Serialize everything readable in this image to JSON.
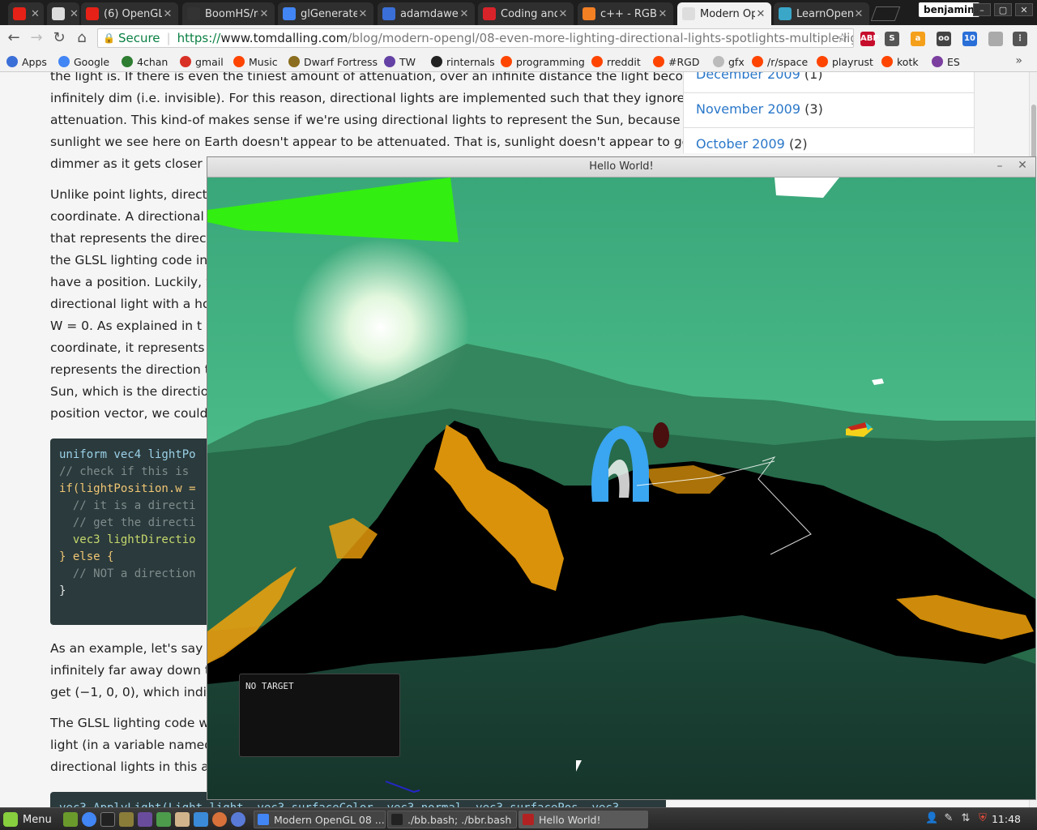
{
  "browser": {
    "tabs": [
      {
        "title": "",
        "favicon": "youtube-icon",
        "color": "#e62117"
      },
      {
        "title": "",
        "favicon": "page-icon",
        "color": "#dddddd"
      },
      {
        "title": "(6) OpenGL",
        "favicon": "youtube-icon",
        "color": "#e62117"
      },
      {
        "title": "BoomHS/re",
        "favicon": "github-icon",
        "color": "#333333"
      },
      {
        "title": "glGenerate",
        "favicon": "google-icon",
        "color": "#4285f4"
      },
      {
        "title": "adamdawe",
        "favicon": "docs-icon",
        "color": "#3b6fd8"
      },
      {
        "title": "Coding and",
        "favicon": "pen-icon",
        "color": "#d9232a"
      },
      {
        "title": "c++ - RGB",
        "favicon": "stackoverflow-icon",
        "color": "#f48024"
      },
      {
        "title": "Modern Op",
        "favicon": "page-icon",
        "color": "#dddddd"
      },
      {
        "title": "LearnOpen",
        "favicon": "learnopengl-icon",
        "color": "#3aa6c8"
      }
    ],
    "user_name": "benjamin",
    "window_controls": [
      "–",
      "▢",
      "✕"
    ],
    "url": {
      "secure_label": "Secure",
      "scheme": "https://",
      "host": "www.tomdalling.com",
      "path": "/blog/modern-opengl/08-even-more-lighting-directional-lights-spotlights-multiple-lights/"
    },
    "extensions": [
      {
        "name": "adblock-icon",
        "label": "ABP",
        "color": "#c70d2c"
      },
      {
        "name": "s-extension-icon",
        "label": "S",
        "color": "#555555"
      },
      {
        "name": "amazon-icon",
        "label": "a",
        "color": "#f5a01a"
      },
      {
        "name": "eyes-extension-icon",
        "label": "oo",
        "color": "#444444"
      },
      {
        "name": "network-extension-icon",
        "label": "10",
        "color": "#2a6fd8"
      },
      {
        "name": "blank-extension-icon",
        "label": "",
        "color": "#aaaaaa"
      },
      {
        "name": "menu-icon",
        "label": "⋮",
        "color": "#555555"
      }
    ],
    "bookmarks": [
      {
        "label": "Apps",
        "icon": "apps-grid-icon",
        "color": "#3b6fd8"
      },
      {
        "label": "Google",
        "icon": "google-icon",
        "color": "#4285f4"
      },
      {
        "label": "4chan",
        "icon": "clover-icon",
        "color": "#2e7d32"
      },
      {
        "label": "gmail",
        "icon": "gmail-icon",
        "color": "#d93025"
      },
      {
        "label": "Music",
        "icon": "reddit-icon",
        "color": "#ff4500"
      },
      {
        "label": "Dwarf Fortress",
        "icon": "df-icon",
        "color": "#8a6d1e"
      },
      {
        "label": "TW",
        "icon": "twitch-icon",
        "color": "#6441a4"
      },
      {
        "label": "rinternals",
        "icon": "github-icon",
        "color": "#222222"
      },
      {
        "label": "programming",
        "icon": "reddit-icon",
        "color": "#ff4500"
      },
      {
        "label": "rreddit",
        "icon": "reddit-icon",
        "color": "#ff4500"
      },
      {
        "label": "#RGD",
        "icon": "reddit-icon",
        "color": "#ff4500"
      },
      {
        "label": "gfx",
        "icon": "page-icon",
        "color": "#bbbbbb"
      },
      {
        "label": "/r/space",
        "icon": "reddit-icon",
        "color": "#ff4500"
      },
      {
        "label": "playrust",
        "icon": "reddit-icon",
        "color": "#ff4500"
      },
      {
        "label": "kotk",
        "icon": "reddit-icon",
        "color": "#ff4500"
      },
      {
        "label": "ES",
        "icon": "es-icon",
        "color": "#7b3fa0"
      }
    ],
    "bookmarks_more": "»"
  },
  "article": {
    "para1": [
      "the light is. If there is even the tiniest amount of attenuation, over an infinite distance the light becomes",
      "infinitely dim (i.e. invisible). For this reason, directional lights are implemented such that they ignore",
      "attenuation. This kind-of makes sense if we're using directional lights to represent the Sun, because the",
      "sunlight we see here on Earth doesn't appear to be attenuated. That is, sunlight doesn't appear to get",
      "dimmer as it gets closer to"
    ],
    "para2": [
      "Unlike point lights, direction",
      "coordinate. A directional lig",
      "that represents the directio",
      "the GLSL lighting code in o",
      "have a position. Luckily, we",
      "directional light with a hom",
      "W = 0. As explained in t",
      "coordinate, it represents the",
      "represents the direction tow",
      "Sun, which is the direction",
      "position vector, we could ha"
    ],
    "code1": [
      "uniform vec4 lightPo",
      "",
      "// check if this is",
      "if(lightPosition.w =",
      "  // it is a directi",
      "  // get the directi",
      "  vec3 lightDirectio",
      "} else {",
      "  // NOT a direction",
      "}"
    ],
    "para3": [
      "As an example, let's say th",
      "infinitely far away down the",
      "get (−1, 0, 0), which indi"
    ],
    "para4": [
      "The GLSL lighting code we",
      "light (in a variable named",
      "directional lights in this artic"
    ],
    "code2": "vec3 ApplyLight(Light light, vec3 surfaceColor, vec3 normal, vec3 surfacePos, vec3"
  },
  "sidebar": {
    "archives": [
      {
        "month": "December 2009",
        "count": "(1)"
      },
      {
        "month": "November 2009",
        "count": "(3)"
      },
      {
        "month": "October 2009",
        "count": "(2)"
      }
    ]
  },
  "game": {
    "window_title": "Hello World!",
    "min_label": "–",
    "close_label": "✕",
    "hud_text": "NO TARGET",
    "colors": {
      "sky_top": "#3aa77a",
      "sky_bottom": "#5fd39a",
      "sun": "#f4ffe8",
      "terrain_dark": "#000000",
      "terrain_fire": "#f2a20c",
      "ground_far": "#1d4a3a",
      "ground_near": "#16352b",
      "green_plane": "#33ee11",
      "ring": "#3aa5f0"
    }
  },
  "taskbar": {
    "menu_label": "Menu",
    "tasks": [
      {
        "label": "Modern OpenGL 08 ...",
        "icon": "chrome-icon",
        "color": "#4285f4"
      },
      {
        "label": "./bb.bash; ./bbr.bash",
        "icon": "terminal-icon",
        "color": "#222222"
      },
      {
        "label": "Hello World!",
        "icon": "app-window-icon",
        "color": "#b22222"
      }
    ],
    "clock": "11:48"
  }
}
